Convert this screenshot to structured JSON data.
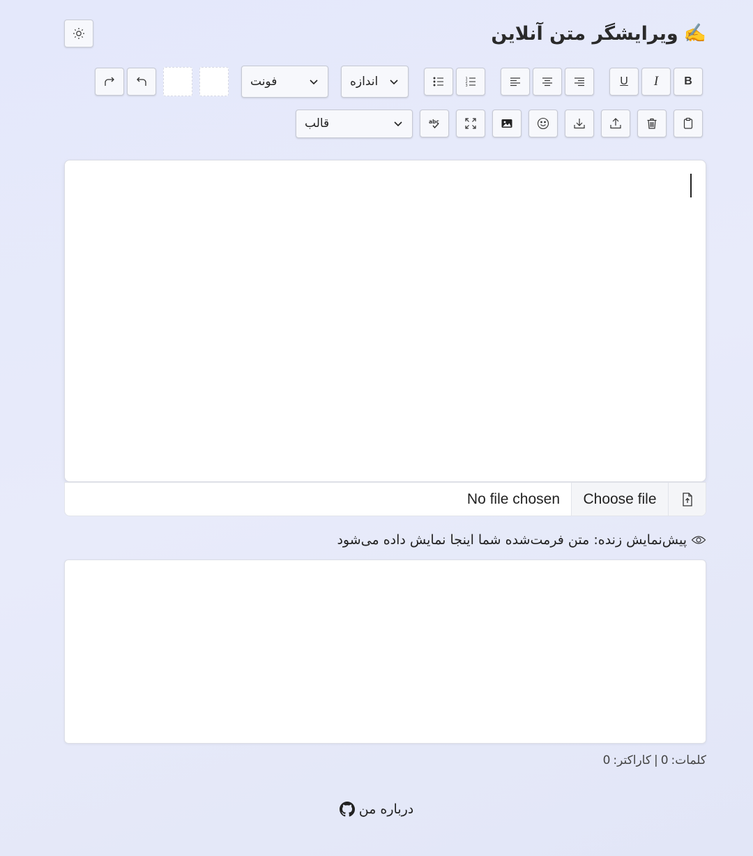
{
  "header": {
    "title": "ویرایشگر متن آنلاین",
    "title_emoji": "✍️",
    "theme_icon": "sun-icon"
  },
  "toolbar": {
    "bold_label": "B",
    "italic_label": "I",
    "underline_label": "U",
    "size_select": {
      "selected": "اندازه"
    },
    "font_select": {
      "selected": "فونت"
    },
    "template_select": {
      "selected": "قالب"
    },
    "icons": {
      "align": [
        "align-right-icon",
        "align-center-icon",
        "align-left-icon"
      ],
      "lists": [
        "ordered-list-icon",
        "unordered-list-icon"
      ],
      "colors": [
        "text-color-swatch",
        "background-color-swatch"
      ],
      "history": [
        "undo-icon",
        "redo-icon"
      ],
      "actions": [
        "paste-icon",
        "delete-icon",
        "upload-icon",
        "download-icon",
        "emoji-icon",
        "image-icon",
        "fullscreen-icon",
        "spellcheck-icon"
      ]
    }
  },
  "editor": {
    "content": ""
  },
  "file_input": {
    "button_label": "Choose file",
    "status": "No file chosen"
  },
  "preview": {
    "label": "پیش‌نمایش زنده: متن فرمت‌شده شما اینجا نمایش داده می‌شود",
    "content": ""
  },
  "stats": {
    "words_label": "کلمات:",
    "words_count": "0",
    "separator": "|",
    "chars_label": "کاراکتر:",
    "chars_count": "0"
  },
  "footer": {
    "link_label": "درباره من",
    "icon": "github-icon"
  },
  "colors": {
    "background": "#e4e8fb",
    "surface": "#ffffff",
    "button": "#f7f8fc",
    "border": "#c6c9d3"
  }
}
